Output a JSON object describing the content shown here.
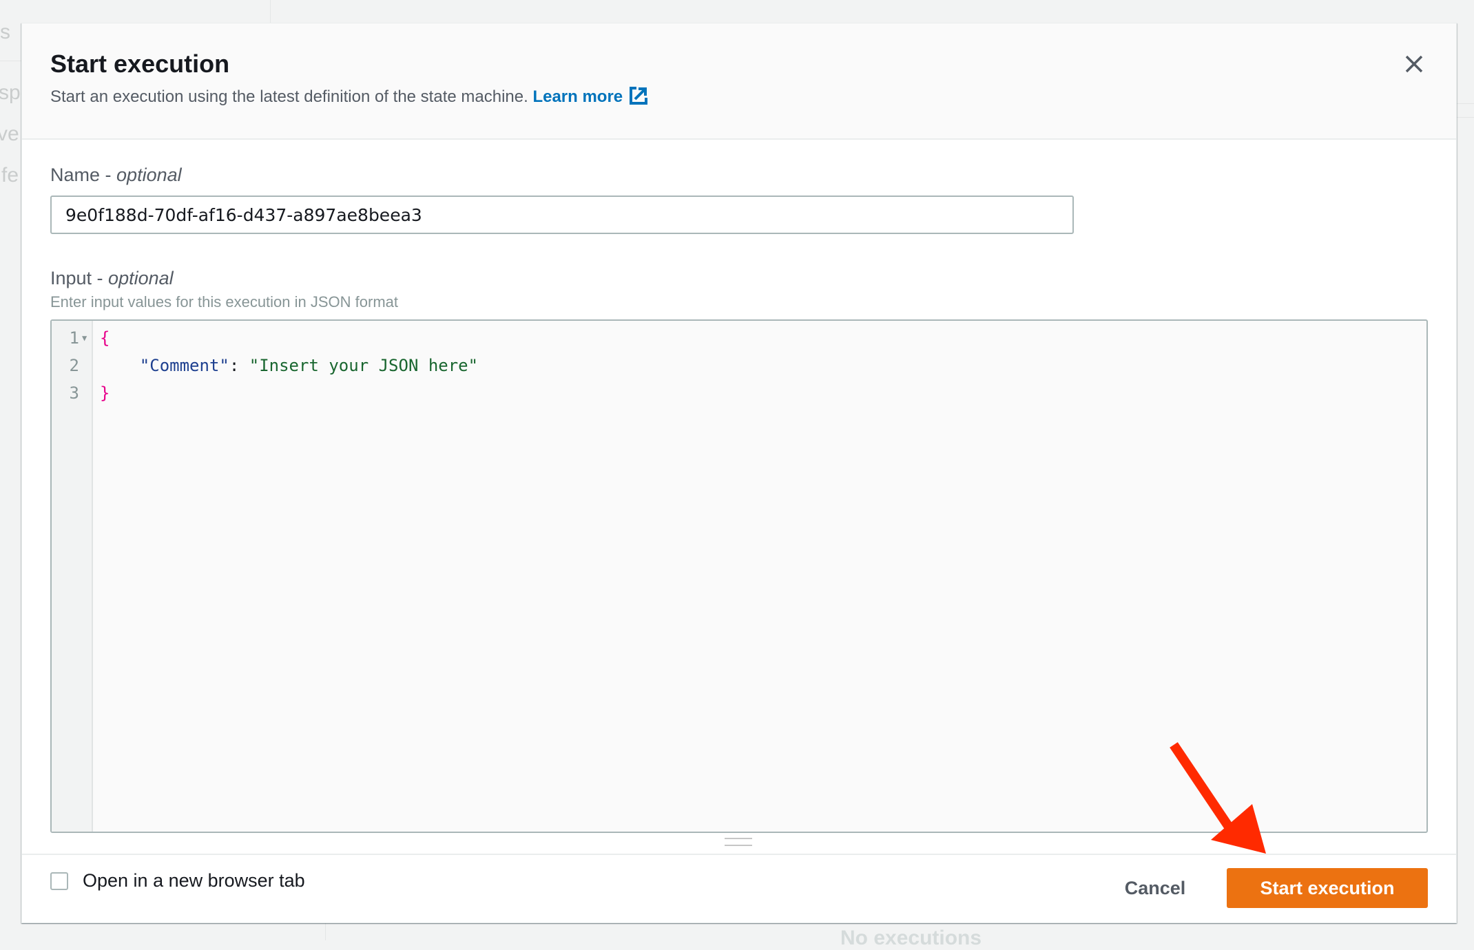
{
  "background": {
    "fragments": [
      "s",
      "spo",
      "ve",
      "fe"
    ],
    "bottom_text": "No executions"
  },
  "modal": {
    "title": "Start execution",
    "subtitle": "Start an execution using the latest definition of the state machine.",
    "learn_more": "Learn more",
    "close_icon": "close-icon",
    "external_link_icon": "external-link-icon"
  },
  "name_field": {
    "label": "Name - ",
    "label_optional": "optional",
    "value": "9e0f188d-70df-af16-d437-a897ae8beea3"
  },
  "input_field": {
    "label": "Input - ",
    "label_optional": "optional",
    "description": "Enter input values for this execution in JSON format",
    "line_numbers": [
      "1",
      "2",
      "3"
    ],
    "code": {
      "open_brace": "{",
      "indent": "    ",
      "key": "\"Comment\"",
      "colon": ": ",
      "value": "\"Insert your JSON here\"",
      "close_brace": "}"
    }
  },
  "footer": {
    "checkbox_label": "Open in a new browser tab",
    "checkbox_checked": false,
    "cancel_label": "Cancel",
    "start_label": "Start execution"
  },
  "colors": {
    "primary": "#ec7211",
    "link": "#0073bb",
    "annotation_arrow": "#ff2a00"
  }
}
